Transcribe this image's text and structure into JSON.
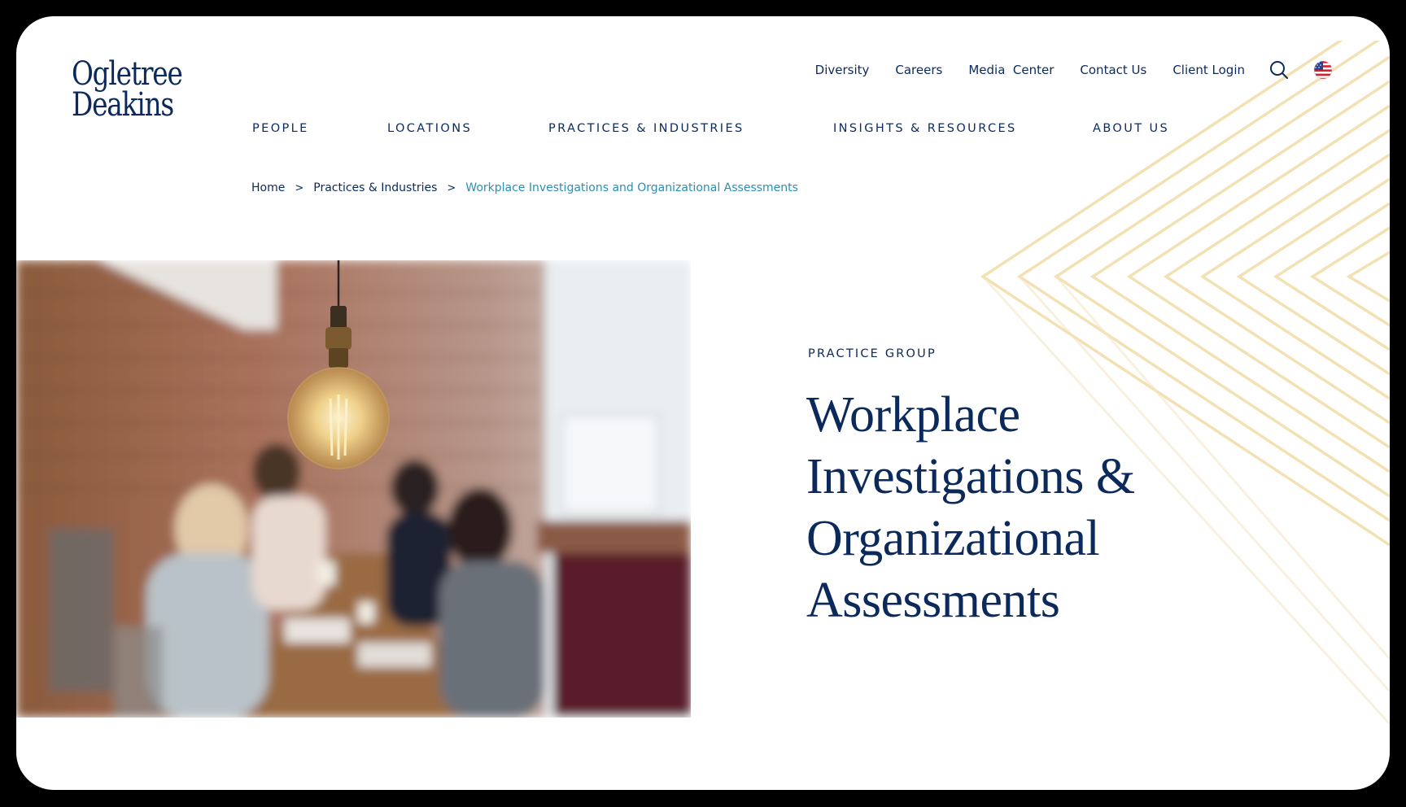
{
  "brand": {
    "logo_line1": "Ogletree",
    "logo_line2": "Deakins"
  },
  "utility_nav": {
    "items": [
      "Diversity",
      "Careers",
      "Media  Center",
      "Contact Us",
      "Client Login"
    ],
    "search_icon": "search-icon",
    "region_icon": "us-flag-icon"
  },
  "main_nav": {
    "items": [
      "PEOPLE",
      "LOCATIONS",
      "PRACTICES & INDUSTRIES",
      "INSIGHTS & RESOURCES",
      "ABOUT US"
    ]
  },
  "breadcrumb": {
    "items": [
      "Home",
      "Practices & Industries",
      "Workplace Investigations and Organizational Assessments"
    ],
    "separator": ">"
  },
  "hero": {
    "eyebrow": "PRACTICE GROUP",
    "title_lines": [
      "Workplace",
      "Investigations &",
      "Organizational",
      "Assessments"
    ],
    "image": "people-meeting-table-lightbulb-photo"
  },
  "colors": {
    "navy": "#0b2a5b",
    "link_blue": "#2a8fb0",
    "accent_gold": "#f1dca8"
  }
}
